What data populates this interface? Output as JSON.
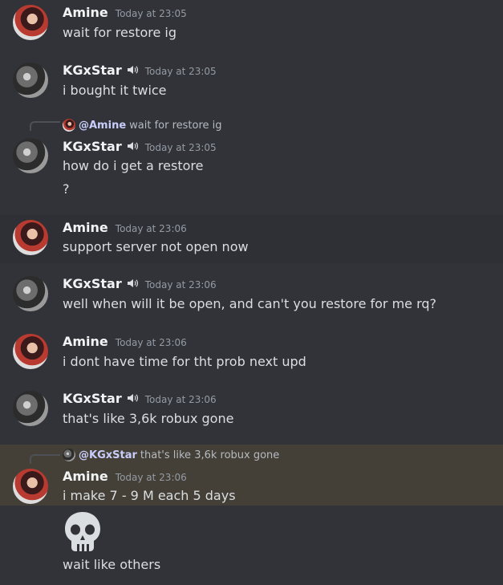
{
  "messages": [
    {
      "author": "Amine",
      "time": "Today at 23:05",
      "lines": [
        "wait for restore ig"
      ]
    },
    {
      "author": "KGxStar",
      "time": "Today at 23:05",
      "lines": [
        "i bought it twice"
      ]
    },
    {
      "reply_to": {
        "author": "@Amine",
        "text": "wait for restore ig"
      },
      "author": "KGxStar",
      "time": "Today at 23:05",
      "lines": [
        "how do i get a restore",
        "?"
      ]
    },
    {
      "author": "Amine",
      "time": "Today at 23:06",
      "lines": [
        "support server not open now"
      ]
    },
    {
      "author": "KGxStar",
      "time": "Today at 23:06",
      "lines": [
        "well when will it be open, and can't you restore for me rq?"
      ]
    },
    {
      "author": "Amine",
      "time": "Today at 23:06",
      "lines": [
        "i dont have time for tht prob next upd"
      ]
    },
    {
      "author": "KGxStar",
      "time": "Today at 23:06",
      "lines": [
        "that's like 3,6k robux gone"
      ]
    },
    {
      "reply_to": {
        "author": "@KGxStar",
        "text": "that's like 3,6k robux gone"
      },
      "author": "Amine",
      "time": "Today at 23:06",
      "lines": [
        "i make 7 - 9 M each 5 days"
      ],
      "emoji": "skull-emoji",
      "follow_up": "wait like others"
    }
  ],
  "colors": {
    "background": "#313338",
    "hover_row": "#2e3035",
    "mention_row": "#444037",
    "username": "#f2f3f5",
    "timestamp": "#949ba4"
  }
}
